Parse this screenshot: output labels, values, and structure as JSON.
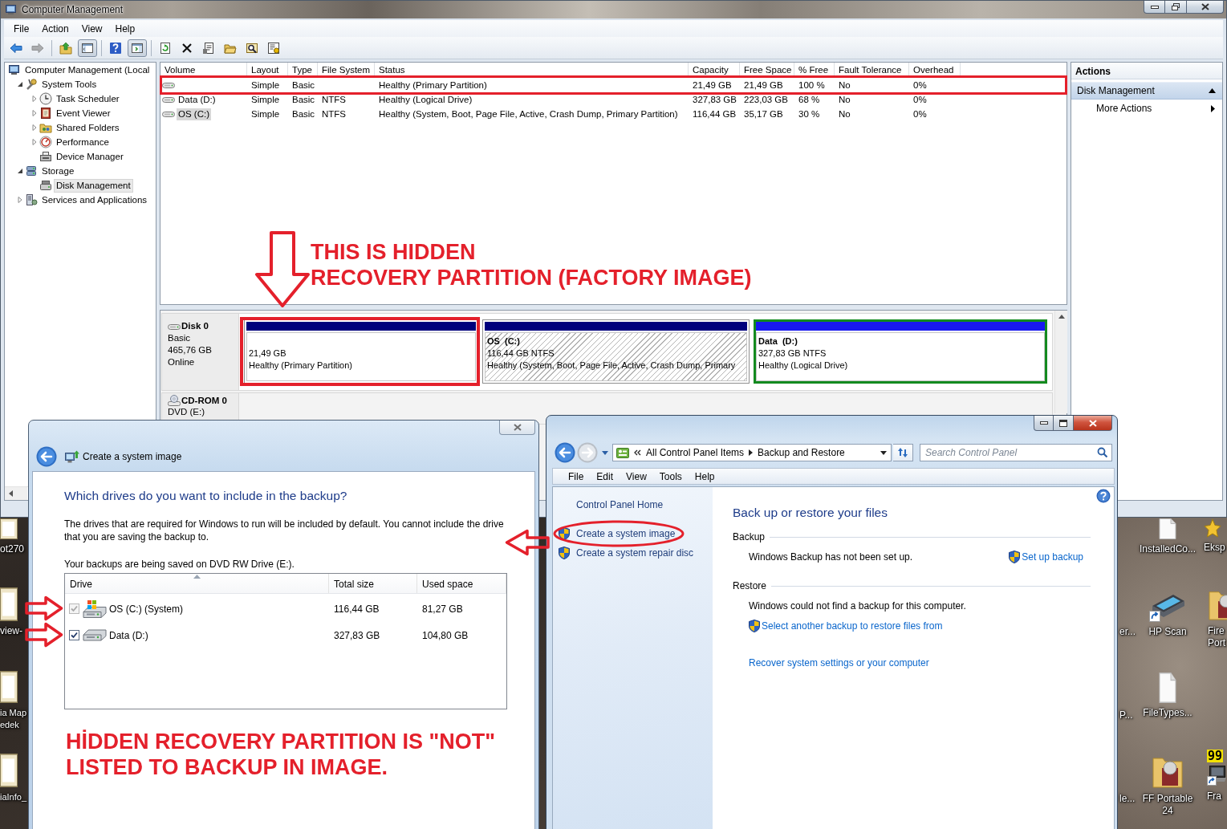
{
  "desktop": {
    "icons": [
      {
        "label": "InstalledCo...",
        "kind": "document"
      },
      {
        "label": "Eksp",
        "kind": "star"
      },
      {
        "label": "er...",
        "kind": "covered"
      },
      {
        "label": "HP Scan",
        "kind": "scanner"
      },
      {
        "label": "Fire Port",
        "kind": "folder"
      },
      {
        "label": "P...",
        "kind": "covered"
      },
      {
        "label": "FileTypes...",
        "kind": "document"
      },
      {
        "label": "le...",
        "kind": "covered"
      },
      {
        "label": "FF Portable 24",
        "kind": "folder"
      },
      {
        "label": "Fra",
        "kind": "laptop",
        "badge": "99"
      },
      {
        "label": "ot270",
        "kind": "file"
      },
      {
        "label": "view-",
        "kind": "file"
      },
      {
        "label": "ia Map edek",
        "kind": "file"
      },
      {
        "label": "iaInfo_",
        "kind": "file"
      }
    ]
  },
  "computer_management": {
    "title": "Computer Management",
    "menu": [
      "File",
      "Action",
      "View",
      "Help"
    ],
    "toolbar": [
      {
        "kind": "back",
        "pressed": false,
        "disabled": false
      },
      {
        "kind": "forward",
        "pressed": false,
        "disabled": true
      },
      {
        "kind": "up",
        "pressed": false,
        "disabled": false
      },
      {
        "kind": "tree-pane",
        "pressed": true,
        "disabled": false
      },
      {
        "kind": "help",
        "pressed": false,
        "disabled": false
      },
      {
        "kind": "action-pane",
        "pressed": true,
        "disabled": false
      },
      {
        "kind": "refresh",
        "pressed": false,
        "disabled": false
      },
      {
        "kind": "delete",
        "pressed": false,
        "disabled": false
      },
      {
        "kind": "properties",
        "pressed": false,
        "disabled": false
      },
      {
        "kind": "open",
        "pressed": false,
        "disabled": false
      },
      {
        "kind": "find",
        "pressed": false,
        "disabled": false
      },
      {
        "kind": "wizard",
        "pressed": false,
        "disabled": false
      }
    ],
    "tree": [
      {
        "label": "Computer Management (Local",
        "selected": false,
        "children": [
          {
            "label": "System Tools",
            "expanded": true,
            "selected": false,
            "children": [
              {
                "label": "Task Scheduler",
                "expanded": false,
                "selected": false
              },
              {
                "label": "Event Viewer",
                "expanded": false,
                "selected": false
              },
              {
                "label": "Shared Folders",
                "expanded": false,
                "selected": false
              },
              {
                "label": "Performance",
                "expanded": false,
                "selected": false
              },
              {
                "label": "Device Manager",
                "selected": false
              }
            ]
          },
          {
            "label": "Storage",
            "expanded": true,
            "selected": false,
            "children": [
              {
                "label": "Disk Management",
                "selected": true
              }
            ]
          },
          {
            "label": "Services and Applications",
            "expanded": false,
            "selected": false
          }
        ]
      }
    ],
    "volumes": {
      "columns": [
        "Volume",
        "Layout",
        "Type",
        "File System",
        "Status",
        "Capacity",
        "Free Space",
        "% Free",
        "Fault Tolerance",
        "Overhead"
      ],
      "rows": [
        {
          "layout": "Simple",
          "type": "Basic",
          "status": "Healthy (Primary Partition)",
          "capacity": "21,49 GB",
          "free_space": "21,49 GB",
          "percent_free": "100 %",
          "fault_tolerance": "No",
          "overhead": "0%",
          "selected": false,
          "marked": true
        },
        {
          "volume": "Data (D:)",
          "layout": "Simple",
          "type": "Basic",
          "file_system": "NTFS",
          "status": "Healthy (Logical Drive)",
          "capacity": "327,83 GB",
          "free_space": "223,03 GB",
          "percent_free": "68 %",
          "fault_tolerance": "No",
          "overhead": "0%",
          "selected": false,
          "marked": false
        },
        {
          "volume": "OS (C:)",
          "layout": "Simple",
          "type": "Basic",
          "file_system": "NTFS",
          "status": "Healthy (System, Boot, Page File, Active, Crash Dump, Primary Partition)",
          "capacity": "116,44 GB",
          "free_space": "35,17 GB",
          "percent_free": "30 %",
          "fault_tolerance": "No",
          "overhead": "0%",
          "selected": true,
          "marked": false
        }
      ]
    },
    "disks": [
      {
        "kind": "disk",
        "name": "Disk 0",
        "type": "Basic",
        "size": "465,76 GB",
        "status": "Online",
        "partitions": [
          {
            "kind": "primary",
            "size": "21,49 GB",
            "status": "Healthy (Primary Partition)",
            "selected": false,
            "marked": true
          },
          {
            "kind": "primary",
            "name": "OS  (C:)",
            "size": "116,44 GB NTFS",
            "status": "Healthy (System, Boot, Page File, Active, Crash Dump, Primary",
            "selected": true,
            "marked": false
          },
          {
            "kind": "logical",
            "name": "Data  (D:)",
            "size": "327,83 GB NTFS",
            "status": "Healthy (Logical Drive)",
            "selected": false,
            "marked": false
          }
        ]
      },
      {
        "kind": "cdrom",
        "name": "CD-ROM 0",
        "type": "DVD (E:)"
      }
    ],
    "actions": {
      "title": "Actions",
      "items": [
        {
          "kind": "group",
          "label": "Disk Management",
          "expanded": true
        },
        {
          "kind": "submenu",
          "label": "More Actions"
        }
      ]
    }
  },
  "backup_dialog": {
    "title": "Create a system image",
    "heading": "Which drives do you want to include in the backup?",
    "description": "The drives that are required for Windows to run will be included by default. You cannot include the drive that you are saving the backup to.",
    "save_location": "Your backups are being saved on DVD RW Drive (E:).",
    "columns": [
      {
        "label": "Drive",
        "sorted": true
      },
      {
        "label": "Total size",
        "sorted": false
      },
      {
        "label": "Used space",
        "sorted": false
      }
    ],
    "drives": [
      {
        "kind": "system",
        "name": "OS (C:) (System)",
        "total_size": "116,44 GB",
        "used_space": "81,27 GB",
        "checked": true,
        "disabled": true,
        "pointed": true
      },
      {
        "kind": "data",
        "name": "Data (D:)",
        "total_size": "327,83 GB",
        "used_space": "104,80 GB",
        "checked": true,
        "disabled": false,
        "pointed": true
      }
    ]
  },
  "control_panel": {
    "nav_buttons": [
      {
        "kind": "back",
        "disabled": false
      },
      {
        "kind": "forward",
        "disabled": true
      }
    ],
    "address": [
      "All Control Panel Items",
      "Backup and Restore"
    ],
    "search": {
      "placeholder": "Search Control Panel"
    },
    "menu": [
      "File",
      "Edit",
      "View",
      "Tools",
      "Help"
    ],
    "nav": [
      {
        "kind": "home",
        "label": "Control Panel Home",
        "circled": false,
        "pointed": false
      },
      {
        "kind": "task",
        "label": "Create a system image",
        "circled": true,
        "pointed": true
      },
      {
        "kind": "task",
        "label": "Create a system repair disc",
        "circled": false,
        "pointed": false
      }
    ],
    "heading": "Back up or restore your files",
    "sections": [
      {
        "kind": "side",
        "title": "Backup",
        "message": "Windows Backup has not been set up.",
        "action": "Set up backup"
      },
      {
        "kind": "stacked",
        "title": "Restore",
        "message": "Windows could not find a backup for this computer.",
        "action": "Select another backup to restore files from"
      }
    ],
    "footer_link": "Recover system settings or your computer"
  },
  "annotations": [
    {
      "kind": "callout",
      "text": "THIS IS HIDDEN\nRECOVERY PARTITION (FACTORY IMAGE)"
    },
    {
      "kind": "note",
      "text": "HİDDEN RECOVERY PARTITION IS \"NOT\"\nLISTED TO BACKUP IN IMAGE."
    }
  ]
}
